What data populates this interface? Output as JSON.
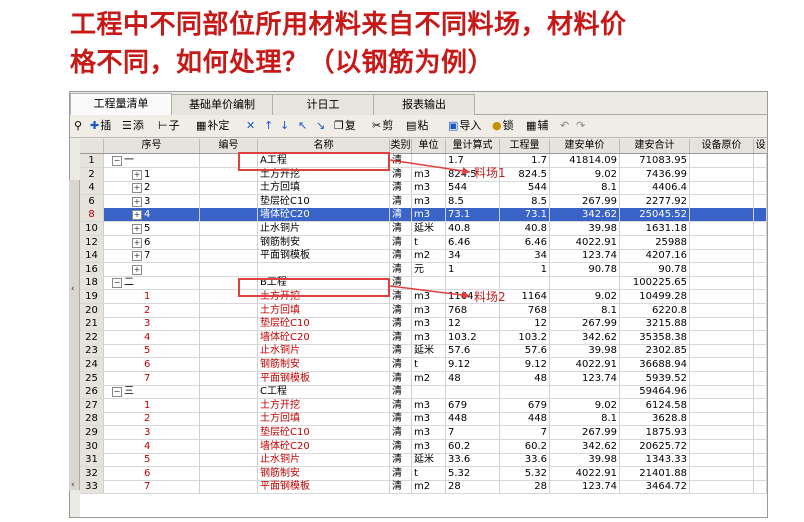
{
  "headline": {
    "line1": "工程中不同部位所用材料来自不同料场，材料价",
    "line2": "格不同，如何处理？（以钢筋为例）"
  },
  "tabs": [
    "工程量清单",
    "基础单价编制",
    "计日工",
    "报表输出"
  ],
  "toolbar": [
    "插",
    "添",
    "子",
    "补定",
    "✕",
    "↑",
    "↓",
    "↖",
    "↘",
    "复",
    "剪",
    "粘",
    "导入",
    "锁",
    "辅"
  ],
  "columns": [
    "序号",
    "编号",
    "名称",
    "类别",
    "单位",
    "量计算式",
    "工程量",
    "建安单价",
    "建安合计",
    "设备原价",
    "设"
  ],
  "annotations": {
    "a": "料场1",
    "b": "料场2"
  },
  "rows": [
    {
      "rn": "1",
      "seq": "一",
      "nm": "A工程",
      "cat": "清",
      "unit": "",
      "expr": "1.7",
      "qty": "1.7",
      "price": "41814.09",
      "total": "71083.95",
      "lvl": "g"
    },
    {
      "rn": "2",
      "seq": "1",
      "nm": "土方开挖",
      "cat": "清",
      "unit": "m3",
      "expr": "824.5",
      "qty": "824.5",
      "price": "9.02",
      "total": "7436.99",
      "lvl": "i"
    },
    {
      "rn": "4",
      "seq": "2",
      "nm": "土方回填",
      "cat": "清",
      "unit": "m3",
      "expr": "544",
      "qty": "544",
      "price": "8.1",
      "total": "4406.4",
      "lvl": "i"
    },
    {
      "rn": "6",
      "seq": "3",
      "nm": "垫层砼C10",
      "cat": "清",
      "unit": "m3",
      "expr": "8.5",
      "qty": "8.5",
      "price": "267.99",
      "total": "2277.92",
      "lvl": "i"
    },
    {
      "rn": "8",
      "seq": "4",
      "nm": "墙体砼C20",
      "cat": "清",
      "unit": "m3",
      "expr": "73.1",
      "qty": "73.1",
      "price": "342.62",
      "total": "25045.52",
      "lvl": "i",
      "sel": true
    },
    {
      "rn": "10",
      "seq": "5",
      "nm": "止水铜片",
      "cat": "清",
      "unit": "延米",
      "expr": "40.8",
      "qty": "40.8",
      "price": "39.98",
      "total": "1631.18",
      "lvl": "i"
    },
    {
      "rn": "12",
      "seq": "6",
      "nm": "钢筋制安",
      "cat": "清",
      "unit": "t",
      "expr": "6.46",
      "qty": "6.46",
      "price": "4022.91",
      "total": "25988",
      "lvl": "i"
    },
    {
      "rn": "14",
      "seq": "7",
      "nm": "平面钢模板",
      "cat": "清",
      "unit": "m2",
      "expr": "34",
      "qty": "34",
      "price": "123.74",
      "total": "4207.16",
      "lvl": "i"
    },
    {
      "rn": "16",
      "seq": "",
      "nm": "",
      "cat": "清",
      "unit": "元",
      "expr": "1",
      "qty": "1",
      "price": "90.78",
      "total": "90.78",
      "lvl": "i"
    },
    {
      "rn": "18",
      "seq": "二",
      "nm": "B工程",
      "cat": "清",
      "unit": "",
      "expr": "",
      "qty": "",
      "price": "",
      "total": "100225.65",
      "lvl": "g"
    },
    {
      "rn": "19",
      "seq": "1",
      "nm": "土方开挖",
      "cat": "清",
      "unit": "m3",
      "expr": "1164",
      "qty": "1164",
      "price": "9.02",
      "total": "10499.28",
      "lvl": "s"
    },
    {
      "rn": "20",
      "seq": "2",
      "nm": "土方回填",
      "cat": "清",
      "unit": "m3",
      "expr": "768",
      "qty": "768",
      "price": "8.1",
      "total": "6220.8",
      "lvl": "s"
    },
    {
      "rn": "21",
      "seq": "3",
      "nm": "垫层砼C10",
      "cat": "清",
      "unit": "m3",
      "expr": "12",
      "qty": "12",
      "price": "267.99",
      "total": "3215.88",
      "lvl": "s"
    },
    {
      "rn": "22",
      "seq": "4",
      "nm": "墙体砼C20",
      "cat": "清",
      "unit": "m3",
      "expr": "103.2",
      "qty": "103.2",
      "price": "342.62",
      "total": "35358.38",
      "lvl": "s"
    },
    {
      "rn": "23",
      "seq": "5",
      "nm": "止水铜片",
      "cat": "清",
      "unit": "延米",
      "expr": "57.6",
      "qty": "57.6",
      "price": "39.98",
      "total": "2302.85",
      "lvl": "s"
    },
    {
      "rn": "24",
      "seq": "6",
      "nm": "钢筋制安",
      "cat": "清",
      "unit": "t",
      "expr": "9.12",
      "qty": "9.12",
      "price": "4022.91",
      "total": "36688.94",
      "lvl": "s"
    },
    {
      "rn": "25",
      "seq": "7",
      "nm": "平面钢模板",
      "cat": "清",
      "unit": "m2",
      "expr": "48",
      "qty": "48",
      "price": "123.74",
      "total": "5939.52",
      "lvl": "s"
    },
    {
      "rn": "26",
      "seq": "三",
      "nm": "C工程",
      "cat": "清",
      "unit": "",
      "expr": "",
      "qty": "",
      "price": "",
      "total": "59464.96",
      "lvl": "g"
    },
    {
      "rn": "27",
      "seq": "1",
      "nm": "土方开挖",
      "cat": "清",
      "unit": "m3",
      "expr": "679",
      "qty": "679",
      "price": "9.02",
      "total": "6124.58",
      "lvl": "s"
    },
    {
      "rn": "28",
      "seq": "2",
      "nm": "土方回填",
      "cat": "清",
      "unit": "m3",
      "expr": "448",
      "qty": "448",
      "price": "8.1",
      "total": "3628.8",
      "lvl": "s"
    },
    {
      "rn": "29",
      "seq": "3",
      "nm": "垫层砼C10",
      "cat": "清",
      "unit": "m3",
      "expr": "7",
      "qty": "7",
      "price": "267.99",
      "total": "1875.93",
      "lvl": "s"
    },
    {
      "rn": "30",
      "seq": "4",
      "nm": "墙体砼C20",
      "cat": "清",
      "unit": "m3",
      "expr": "60.2",
      "qty": "60.2",
      "price": "342.62",
      "total": "20625.72",
      "lvl": "s"
    },
    {
      "rn": "31",
      "seq": "5",
      "nm": "止水铜片",
      "cat": "清",
      "unit": "延米",
      "expr": "33.6",
      "qty": "33.6",
      "price": "39.98",
      "total": "1343.33",
      "lvl": "s"
    },
    {
      "rn": "32",
      "seq": "6",
      "nm": "钢筋制安",
      "cat": "清",
      "unit": "t",
      "expr": "5.32",
      "qty": "5.32",
      "price": "4022.91",
      "total": "21401.88",
      "lvl": "s"
    },
    {
      "rn": "33",
      "seq": "7",
      "nm": "平面钢模板",
      "cat": "清",
      "unit": "m2",
      "expr": "28",
      "qty": "28",
      "price": "123.74",
      "total": "3464.72",
      "lvl": "s"
    }
  ]
}
